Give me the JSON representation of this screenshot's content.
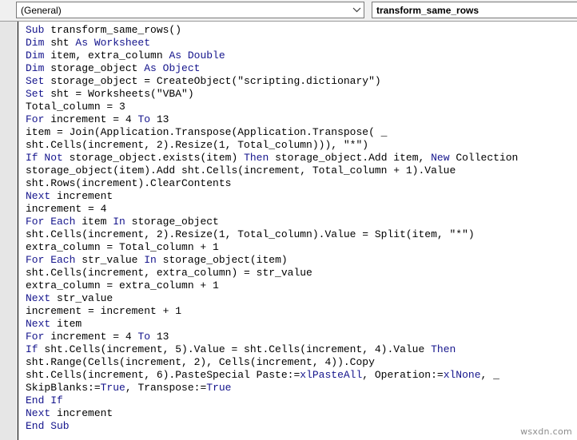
{
  "toolbar": {
    "procedure_combo": {
      "value": "(General)",
      "arrow_icon": "chevron-down-icon"
    },
    "object_combo": {
      "value": "transform_same_rows"
    }
  },
  "code_window": {
    "language": "VBA",
    "keyword_color": "#14148c",
    "text_color": "#000000",
    "background_color": "#ffffff",
    "margin_bar_color": "#e6e6e6",
    "lines": [
      [
        {
          "t": "Sub",
          "k": true
        },
        {
          "t": " transform_same_rows()",
          "k": false
        }
      ],
      [
        {
          "t": "Dim",
          "k": true
        },
        {
          "t": " sht ",
          "k": false
        },
        {
          "t": "As Worksheet",
          "k": true
        }
      ],
      [
        {
          "t": "Dim",
          "k": true
        },
        {
          "t": " item, extra_column ",
          "k": false
        },
        {
          "t": "As Double",
          "k": true
        }
      ],
      [
        {
          "t": "Dim",
          "k": true
        },
        {
          "t": " storage_object ",
          "k": false
        },
        {
          "t": "As Object",
          "k": true
        }
      ],
      [
        {
          "t": "Set",
          "k": true
        },
        {
          "t": " storage_object = CreateObject(\"scripting.dictionary\")",
          "k": false
        }
      ],
      [
        {
          "t": "Set",
          "k": true
        },
        {
          "t": " sht = Worksheets(\"VBA\")",
          "k": false
        }
      ],
      [
        {
          "t": "Total_column = 3",
          "k": false
        }
      ],
      [
        {
          "t": "For",
          "k": true
        },
        {
          "t": " increment = 4 ",
          "k": false
        },
        {
          "t": "To",
          "k": true
        },
        {
          "t": " 13",
          "k": false
        }
      ],
      [
        {
          "t": "item = Join(Application.Transpose(Application.Transpose( _",
          "k": false
        }
      ],
      [
        {
          "t": "sht.Cells(increment, 2).Resize(1, Total_column))), \"*\")",
          "k": false
        }
      ],
      [
        {
          "t": "If Not",
          "k": true
        },
        {
          "t": " storage_object.exists(item) ",
          "k": false
        },
        {
          "t": "Then",
          "k": true
        },
        {
          "t": " storage_object.Add item, ",
          "k": false
        },
        {
          "t": "New",
          "k": true
        },
        {
          "t": " Collection",
          "k": false
        }
      ],
      [
        {
          "t": "storage_object(item).Add sht.Cells(increment, Total_column + 1).Value",
          "k": false
        }
      ],
      [
        {
          "t": "sht.Rows(increment).ClearContents",
          "k": false
        }
      ],
      [
        {
          "t": "Next",
          "k": true
        },
        {
          "t": " increment",
          "k": false
        }
      ],
      [
        {
          "t": "increment = 4",
          "k": false
        }
      ],
      [
        {
          "t": "For Each",
          "k": true
        },
        {
          "t": " item ",
          "k": false
        },
        {
          "t": "In",
          "k": true
        },
        {
          "t": " storage_object",
          "k": false
        }
      ],
      [
        {
          "t": "sht.Cells(increment, 2).Resize(1, Total_column).Value = Split(item, \"*\")",
          "k": false
        }
      ],
      [
        {
          "t": "extra_column = Total_column + 1",
          "k": false
        }
      ],
      [
        {
          "t": "For Each",
          "k": true
        },
        {
          "t": " str_value ",
          "k": false
        },
        {
          "t": "In",
          "k": true
        },
        {
          "t": " storage_object(item)",
          "k": false
        }
      ],
      [
        {
          "t": "sht.Cells(increment, extra_column) = str_value",
          "k": false
        }
      ],
      [
        {
          "t": "extra_column = extra_column + 1",
          "k": false
        }
      ],
      [
        {
          "t": "Next",
          "k": true
        },
        {
          "t": " str_value",
          "k": false
        }
      ],
      [
        {
          "t": "increment = increment + 1",
          "k": false
        }
      ],
      [
        {
          "t": "Next",
          "k": true
        },
        {
          "t": " item",
          "k": false
        }
      ],
      [
        {
          "t": "For",
          "k": true
        },
        {
          "t": " increment = 4 ",
          "k": false
        },
        {
          "t": "To",
          "k": true
        },
        {
          "t": " 13",
          "k": false
        }
      ],
      [
        {
          "t": "If",
          "k": true
        },
        {
          "t": " sht.Cells(increment, 5).Value = sht.Cells(increment, 4).Value ",
          "k": false
        },
        {
          "t": "Then",
          "k": true
        }
      ],
      [
        {
          "t": "sht.Range(Cells(increment, 2), Cells(increment, 4)).Copy",
          "k": false
        }
      ],
      [
        {
          "t": "sht.Cells(increment, 6).PasteSpecial Paste:=",
          "k": false
        },
        {
          "t": "xlPasteAll",
          "k": true
        },
        {
          "t": ", Operation:=",
          "k": false
        },
        {
          "t": "xlNone",
          "k": true
        },
        {
          "t": ", _",
          "k": false
        }
      ],
      [
        {
          "t": "SkipBlanks:=",
          "k": false
        },
        {
          "t": "True",
          "k": true
        },
        {
          "t": ", Transpose:=",
          "k": false
        },
        {
          "t": "True",
          "k": true
        }
      ],
      [
        {
          "t": "End If",
          "k": true
        }
      ],
      [
        {
          "t": "Next",
          "k": true
        },
        {
          "t": " increment",
          "k": false
        }
      ],
      [
        {
          "t": "End Sub",
          "k": true
        }
      ]
    ]
  },
  "watermark": {
    "text": "wsxdn.com"
  }
}
